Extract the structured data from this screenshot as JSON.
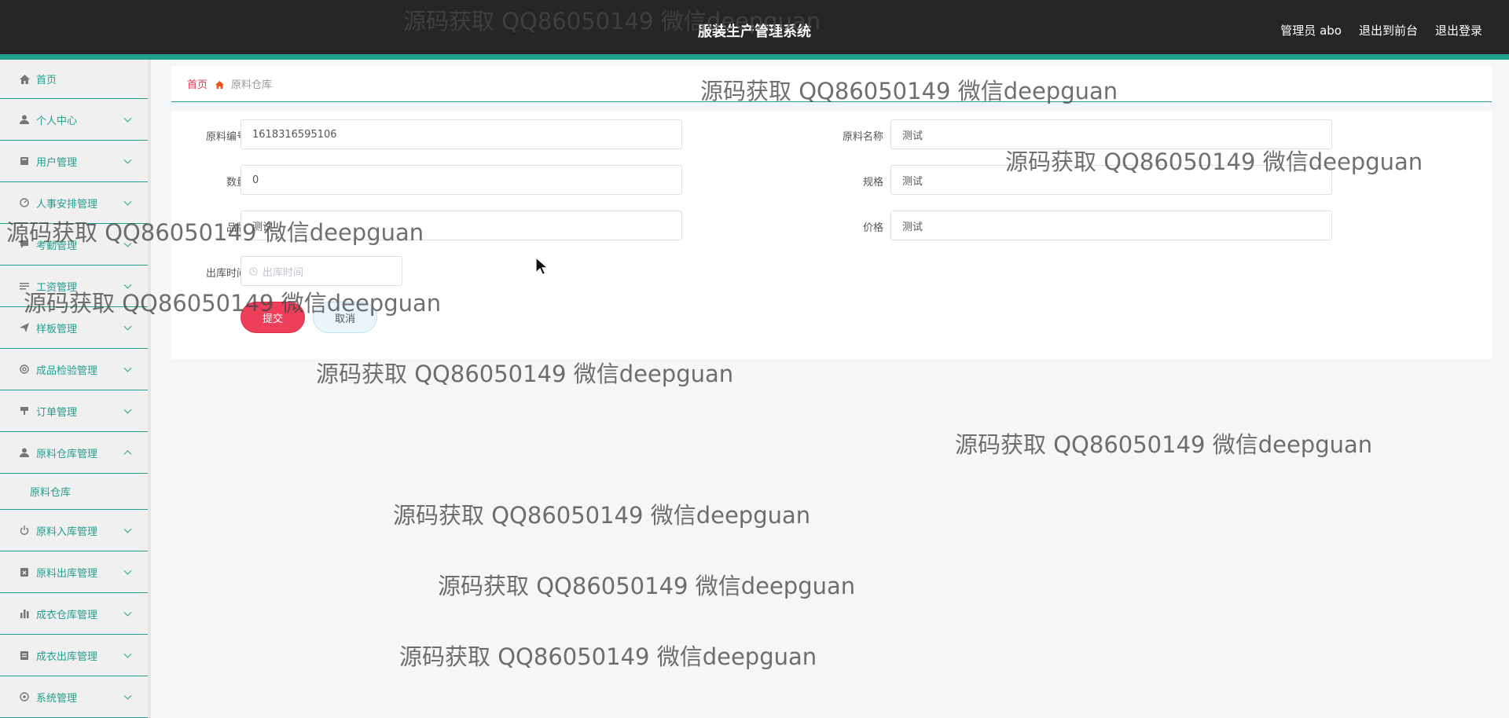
{
  "header": {
    "title": "服装生产管理系统",
    "actions": [
      "管理员 abo",
      "退出到前台",
      "退出登录"
    ]
  },
  "sidebar": {
    "items": [
      {
        "label": "首页",
        "icon": "home-icon"
      },
      {
        "label": "个人中心",
        "icon": "user-icon"
      },
      {
        "label": "用户管理",
        "icon": "book-icon"
      },
      {
        "label": "人事安排管理",
        "icon": "dashboard-icon"
      },
      {
        "label": "考勤管理",
        "icon": "comment-icon"
      },
      {
        "label": "工资管理",
        "icon": "list-icon"
      },
      {
        "label": "样板管理",
        "icon": "send-icon"
      },
      {
        "label": "成品检验管理",
        "icon": "support-icon"
      },
      {
        "label": "订单管理",
        "icon": "gavel-icon"
      },
      {
        "label": "原料仓库管理",
        "icon": "user-icon"
      },
      {
        "label": "原料入库管理",
        "icon": "power-icon"
      },
      {
        "label": "原料出库管理",
        "icon": "clipboard-x-icon"
      },
      {
        "label": "成衣仓库管理",
        "icon": "bar-chart-icon"
      },
      {
        "label": "成衣出库管理",
        "icon": "clipboard-icon"
      },
      {
        "label": "系统管理",
        "icon": "settings-icon"
      }
    ],
    "expanded_submenu": "原料仓库"
  },
  "breadcrumb": {
    "home": "首页",
    "current": "原料仓库"
  },
  "form": {
    "code_label": "原料编号",
    "code_value": "1618316595106",
    "name_label": "原料名称",
    "name_value": "测试",
    "qty_label": "数量",
    "qty_value": "0",
    "spec_label": "规格",
    "spec_value": "测试",
    "brand_label": "品牌",
    "brand_value": "测试",
    "price_label": "价格",
    "price_value": "测试",
    "out_time_label": "出库时间",
    "out_time_placeholder": "出库时间",
    "submit_label": "提交",
    "cancel_label": "取消"
  },
  "watermark": "源码获取 QQ86050149 微信deepguan",
  "colors": {
    "accent": "#21a08c",
    "topbar": "#262626",
    "submit": "#ee3f5a",
    "breadcrumb_home": "#e0374f"
  }
}
